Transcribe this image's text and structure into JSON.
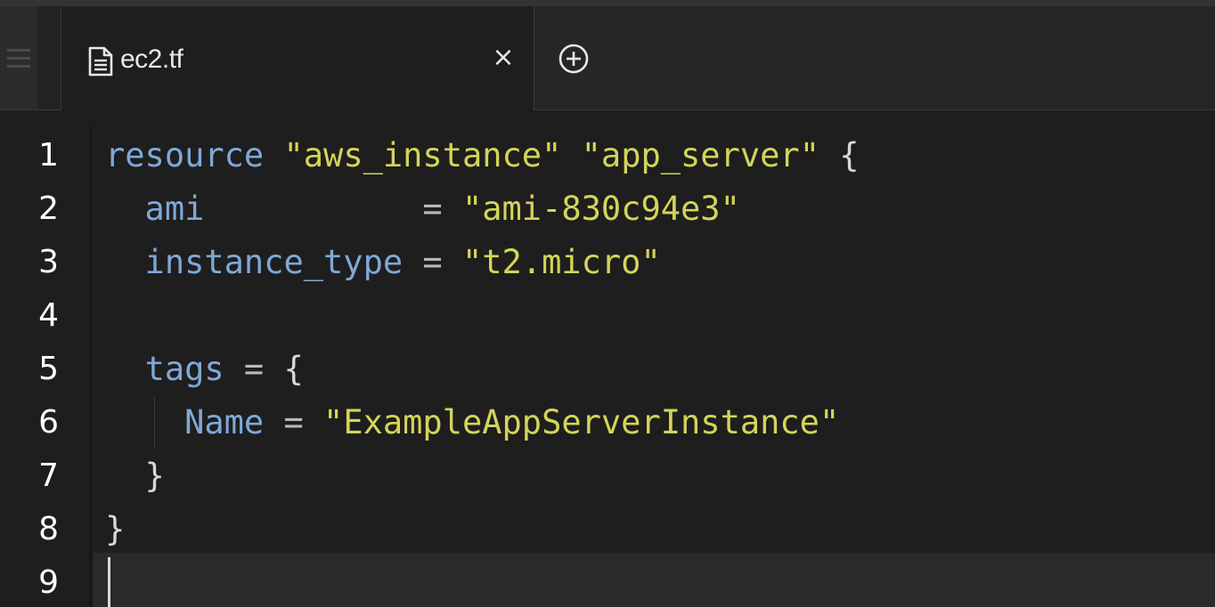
{
  "tab": {
    "file_icon": "file-text-icon",
    "label": "ec2.tf",
    "close_glyph": "×",
    "close_icon": "close-icon",
    "new_tab_icon": "plus-circle-icon"
  },
  "menu": {
    "icon": "hamburger-menu-icon"
  },
  "editor": {
    "line_numbers": [
      "1",
      "2",
      "3",
      "4",
      "5",
      "6",
      "7",
      "8",
      "9"
    ],
    "current_line": "9",
    "lines": [
      {
        "t1": "resource",
        "t2": " ",
        "t3": "\"aws_instance\"",
        "t4": " ",
        "t5": "\"app_server\"",
        "t6": " {"
      },
      {
        "t1": "  ami",
        "t2": "           = ",
        "t3": "\"ami-830c94e3\""
      },
      {
        "t1": "  instance_type",
        "t2": " = ",
        "t3": "\"t2.micro\""
      },
      {},
      {
        "t1": "  tags",
        "t2": " = ",
        "t3": "{"
      },
      {
        "t1": "    Name",
        "t2": " = ",
        "t3": "\"ExampleAppServerInstance\""
      },
      {
        "t1": "  }"
      },
      {
        "t1": "}"
      },
      {}
    ]
  },
  "colors": {
    "keyword": "#7fa8d8",
    "string": "#d4d459",
    "background": "#1e1e1e",
    "line_number": "#ffffff"
  }
}
